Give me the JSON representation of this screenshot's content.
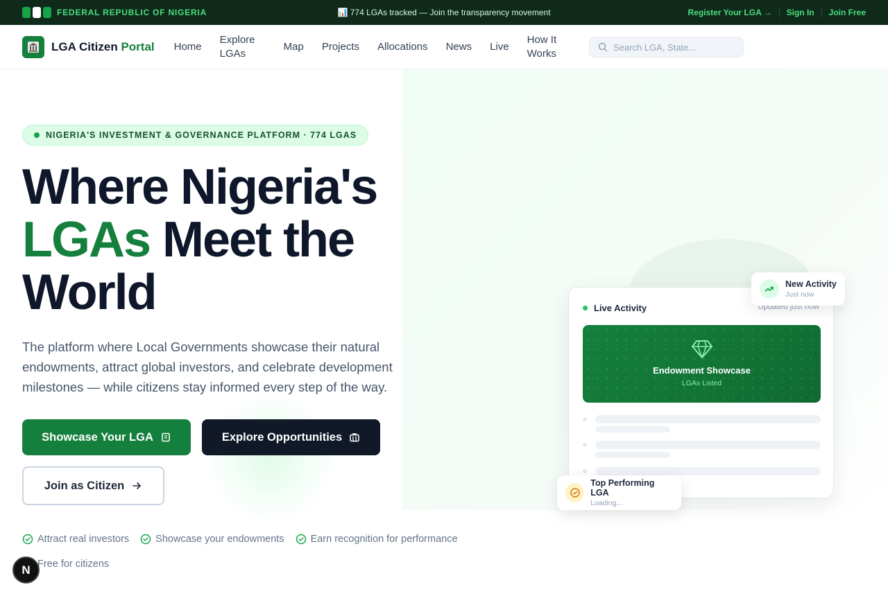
{
  "topbar": {
    "brand": "FEDERAL REPUBLIC OF NIGERIA",
    "announcement": "📊 774 LGAs tracked — Join the transparency movement",
    "register": "Register Your LGA →",
    "sign_in": "Sign In",
    "join": "Join Free"
  },
  "navbar": {
    "logo_main": "LGA Citizen ",
    "logo_accent": "Portal",
    "items": [
      "Home",
      "Explore LGAs",
      "Map",
      "Projects",
      "Allocations",
      "News",
      "Live",
      "How It Works"
    ],
    "search_placeholder": "Search LGA, State..."
  },
  "hero": {
    "badge": "NIGERIA'S INVESTMENT & GOVERNANCE PLATFORM · 774 LGAS",
    "headline_line1": "Where Nigeria's",
    "headline_green": "LGAs",
    "headline_line2_rest": " Meet the",
    "headline_line3": "World",
    "subtext": "The platform where Local Governments showcase their natural endowments, attract global investors, and celebrate development milestones — while citizens stay informed every step of the way.",
    "btn_showcase": "Showcase Your LGA",
    "btn_explore": "Explore Opportunities",
    "btn_join": "Join as Citizen",
    "checks": [
      "Attract real investors",
      "Showcase your endowments",
      "Earn recognition for performance",
      "Free for citizens"
    ]
  },
  "card": {
    "title": "Live Activity",
    "updated": "Updated just now",
    "showcase_title": "Endowment Showcase",
    "showcase_sub": "LGAs Listed"
  },
  "chips": {
    "new_title": "New Activity",
    "new_sub": "Just now",
    "top_title": "Top Performing LGA",
    "top_sub": "Loading..."
  },
  "misc": {
    "n_badge": "N"
  },
  "colors": {
    "brand_green": "#15803d",
    "dark": "#111827",
    "topbar_bg": "#0f2a1a"
  }
}
